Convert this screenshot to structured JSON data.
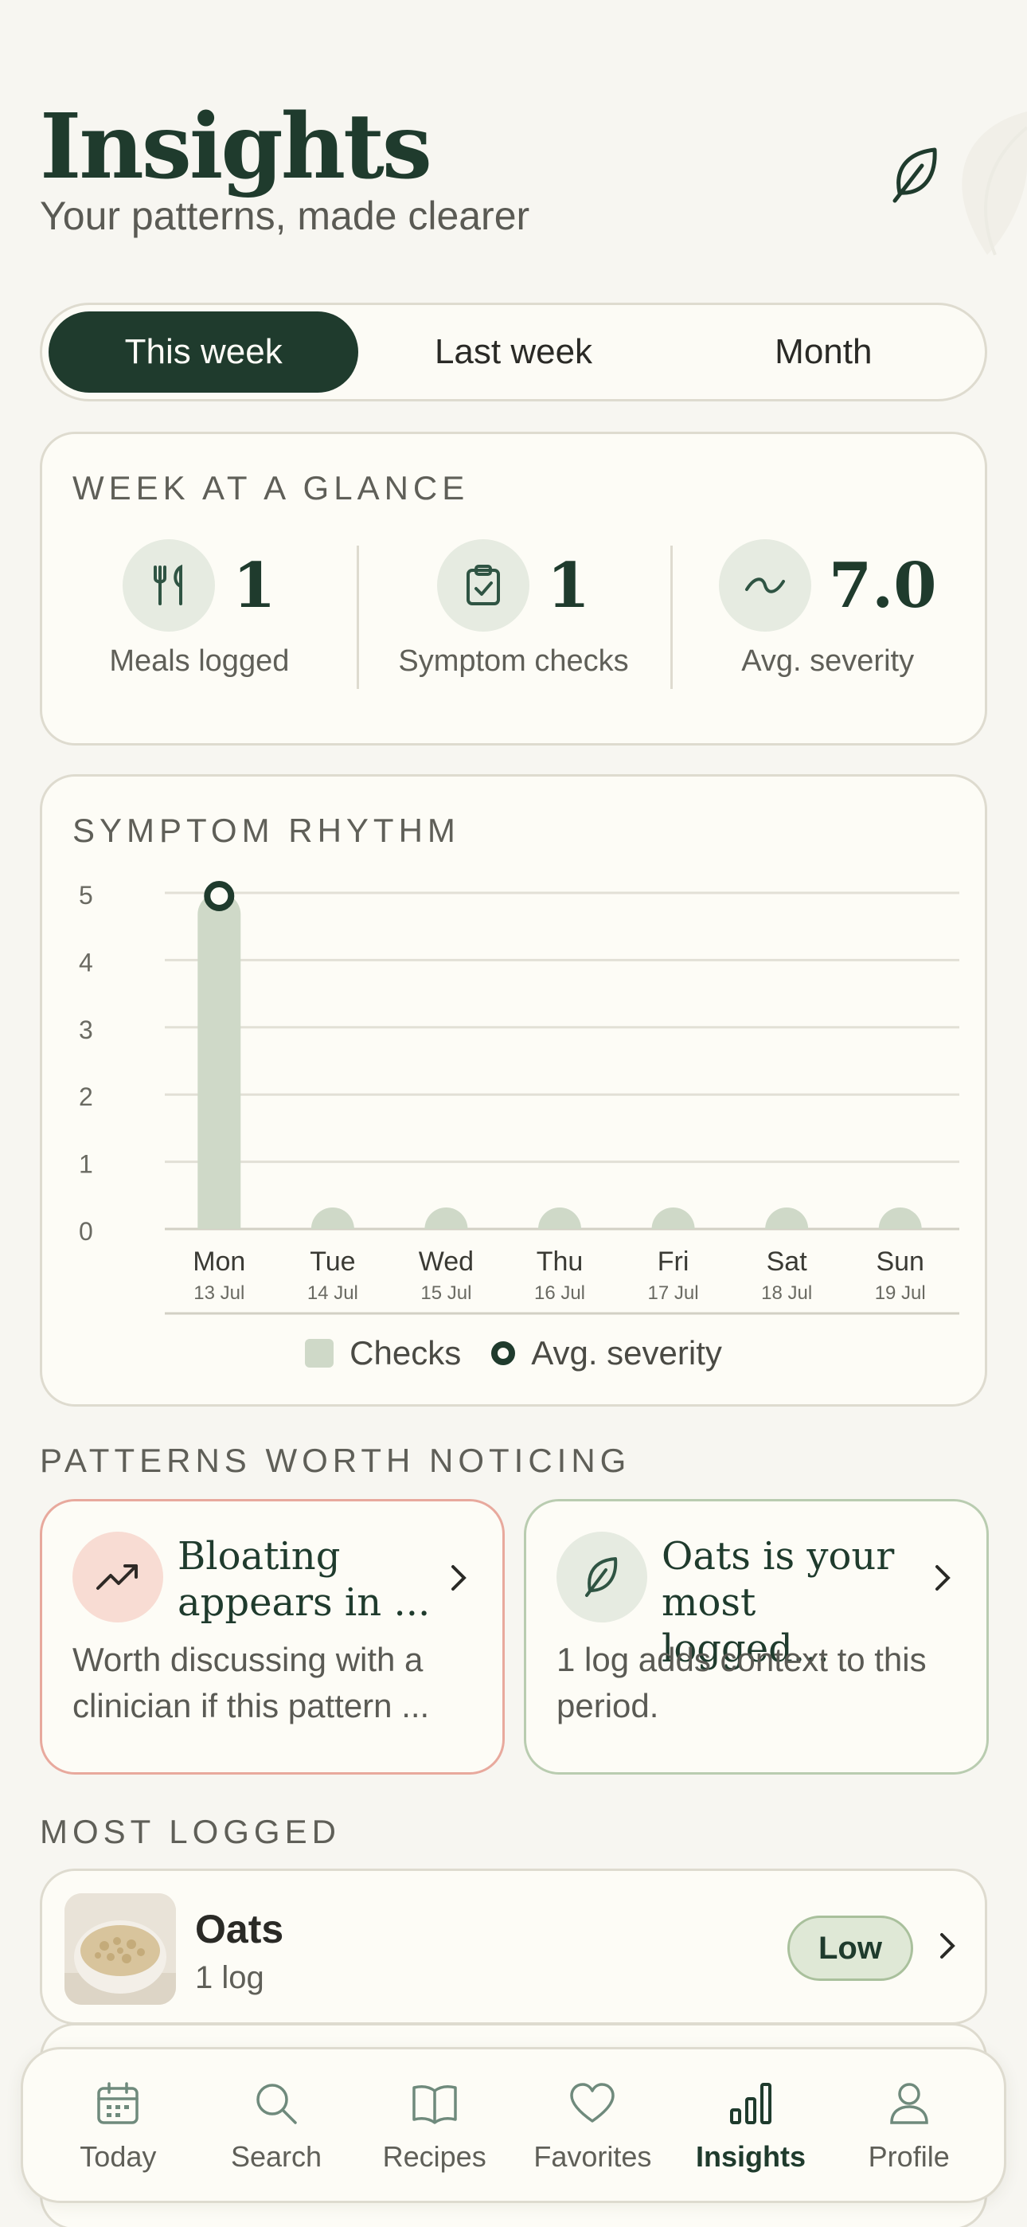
{
  "header": {
    "title": "Insights",
    "subtitle": "Your patterns, made clearer"
  },
  "segments": [
    {
      "label": "This week",
      "active": true
    },
    {
      "label": "Last week",
      "active": false
    },
    {
      "label": "Month",
      "active": false
    }
  ],
  "glance": {
    "label": "WEEK AT A GLANCE",
    "stats": [
      {
        "icon": "utensils-icon",
        "value": "1",
        "label": "Meals logged"
      },
      {
        "icon": "clipboard-check-icon",
        "value": "1",
        "label": "Symptom checks"
      },
      {
        "icon": "wave-icon",
        "value": "7.0",
        "label": "Avg. severity"
      }
    ]
  },
  "rhythm": {
    "label": "SYMPTOM RHYTHM",
    "legend": {
      "checks": "Checks",
      "severity": "Avg. severity"
    }
  },
  "chart_data": {
    "type": "bar",
    "categories": [
      "Mon",
      "Tue",
      "Wed",
      "Thu",
      "Fri",
      "Sat",
      "Sun"
    ],
    "dates": [
      "13 Jul",
      "14 Jul",
      "15 Jul",
      "16 Jul",
      "17 Jul",
      "18 Jul",
      "19 Jul"
    ],
    "series": [
      {
        "name": "Checks",
        "values": [
          5,
          0,
          0,
          0,
          0,
          0,
          0
        ]
      },
      {
        "name": "Avg. severity",
        "values": [
          5,
          null,
          null,
          null,
          null,
          null,
          null
        ]
      }
    ],
    "yticks": [
      "0",
      "1",
      "2",
      "3",
      "4",
      "5"
    ],
    "ylim": [
      0,
      5
    ],
    "grid": true,
    "legend": "bottom",
    "colors": {
      "bar": "#cfd9c8",
      "marker": "#1f3b2d"
    }
  },
  "patterns": {
    "label": "PATTERNS WORTH NOTICING",
    "cards": [
      {
        "icon": "trend-up-icon",
        "title": "Bloating appears in ...",
        "body": "Worth discussing with a clinician if this pattern ..."
      },
      {
        "icon": "leaf-icon",
        "title": "Oats is your most logged...",
        "body": "1 log adds context to this period."
      }
    ]
  },
  "most_logged": {
    "label": "MOST LOGGED",
    "items": [
      {
        "name": "Oats",
        "count": "1 log",
        "badge": "Low"
      }
    ]
  },
  "tabbar": [
    {
      "icon": "calendar-icon",
      "label": "Today"
    },
    {
      "icon": "search-icon",
      "label": "Search"
    },
    {
      "icon": "book-icon",
      "label": "Recipes"
    },
    {
      "icon": "heart-icon",
      "label": "Favorites"
    },
    {
      "icon": "bar-chart-icon",
      "label": "Insights",
      "active": true
    },
    {
      "icon": "person-icon",
      "label": "Profile"
    }
  ]
}
